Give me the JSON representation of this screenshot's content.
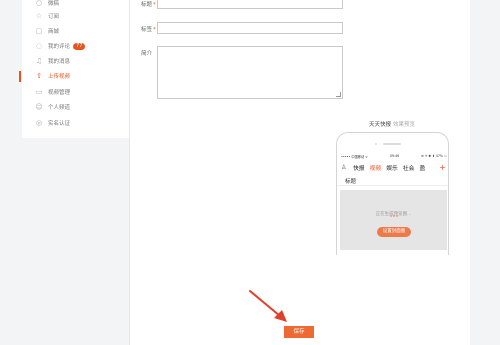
{
  "sidebar": {
    "items": [
      {
        "label": "微稿",
        "icon": "draft-icon"
      },
      {
        "label": "订阅",
        "icon": "star-icon"
      },
      {
        "label": "商城",
        "icon": "shop-icon"
      },
      {
        "label": "我的评论",
        "icon": "comment-icon",
        "badge": "77"
      },
      {
        "label": "我的消息",
        "icon": "bell-icon"
      },
      {
        "label": "上传视频",
        "icon": "upload-icon",
        "active": true
      },
      {
        "label": "视频管理",
        "icon": "video-manage-icon"
      },
      {
        "label": "个人频道",
        "icon": "person-icon"
      },
      {
        "label": "实名认证",
        "icon": "verify-icon"
      }
    ]
  },
  "form": {
    "title_label": "标题",
    "tags_label": "标签",
    "intro_label": "简介",
    "required_mark": "*"
  },
  "preview": {
    "title": "天天快报",
    "subtitle": "效果预览",
    "status_left": "••••• 中国移动 ᯤ",
    "status_mid": "09:46",
    "status_right": "⊕ ✈ ✱ ⬆ 47% ▭",
    "tabs": [
      "快报",
      "视频",
      "娱乐",
      "社会",
      "盈"
    ],
    "active_tab": "视频",
    "video_title": "标题",
    "video_text": "正在生成预览图...",
    "video_button": "设置封面图"
  },
  "actions": {
    "save_label": "保存"
  },
  "colors": {
    "accent": "#e8541e",
    "button": "#ee6a33",
    "arrow": "#e0402a"
  }
}
